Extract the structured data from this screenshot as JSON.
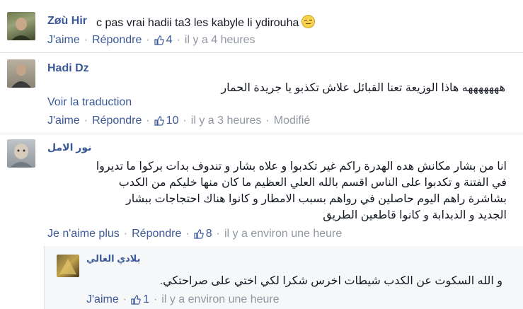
{
  "comments": [
    {
      "author": "Zøù Hir",
      "text": "c pas vrai hadii ta3 les kabyle li ydirouha",
      "emoji_icon": "unamused-face-icon",
      "actions": {
        "like": "J'aime",
        "reply": "Répondre",
        "likes": "4",
        "time": "il y a 4 heures"
      }
    },
    {
      "author": "Hadi Dz",
      "text": "هههههههه هاذا الوزيعة تعنا القبائل علاش تكذبو يا جريدة الحمار",
      "translate": "Voir la traduction",
      "actions": {
        "like": "J'aime",
        "reply": "Répondre",
        "likes": "10",
        "time": "il y a 3 heures",
        "edited": "Modifié"
      }
    },
    {
      "author": "نور الامل",
      "lines": [
        "انا من بشار مكانش هده الهدرة راكم غير تكدبوا و علاه بشار و تندوف بدات بركوا ما تديروا",
        "في الفتنة و تكدبوا على الناس اقسم بالله العلي العظيم ما كان منها خليكم من الكدب",
        "بشاشرة راهم اليوم حاصلين في رواهم بسبب الامطار و كانوا هناك احتجاجات ببشار",
        "الجديد و الدبدابة و كانوا قاطعين الطريق"
      ],
      "actions": {
        "like": "Je n'aime plus",
        "reply": "Répondre",
        "likes": "8",
        "time": "il y a environ une heure"
      }
    }
  ],
  "reply": {
    "author": "بلادي الغالي",
    "text": "و الله السكوت عن الكدب شيطات اخرس شكرا لكي اختي على صراحتكي.",
    "actions": {
      "like": "J'aime",
      "likes": "1",
      "time": "il y a environ une heure"
    }
  },
  "colors": {
    "link": "#3b5998",
    "meta": "#9197a3",
    "text": "#141823"
  }
}
